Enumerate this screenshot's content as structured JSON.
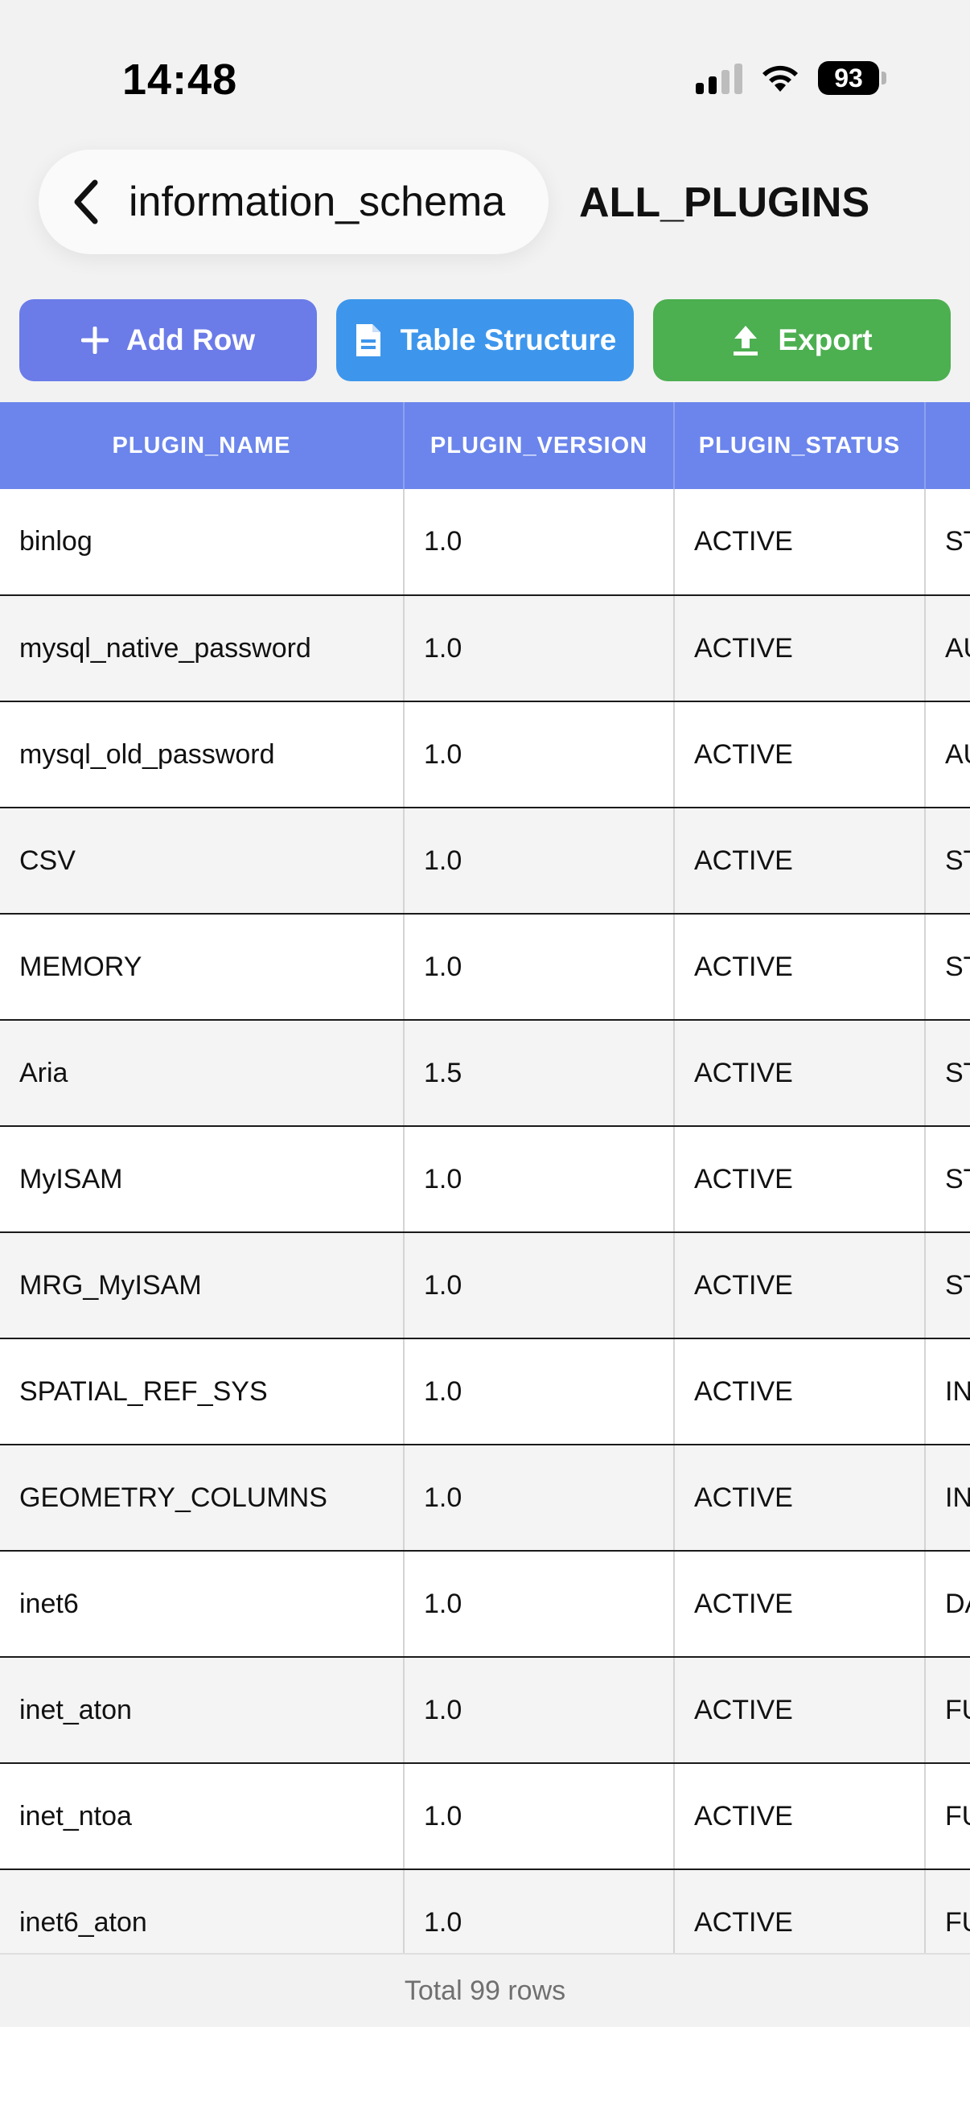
{
  "status_bar": {
    "time": "14:48",
    "battery": "93"
  },
  "nav": {
    "back_label": "information_schema",
    "title": "ALL_PLUGINS"
  },
  "toolbar": {
    "add_row_label": "Add Row",
    "table_structure_label": "Table Structure",
    "export_label": "Export"
  },
  "colors": {
    "header": "#6b85ec",
    "add_row": "#6b7be8",
    "table_structure": "#3d96ec",
    "export": "#4caf50"
  },
  "table": {
    "columns": [
      "PLUGIN_NAME",
      "PLUGIN_VERSION",
      "PLUGIN_STATUS",
      ""
    ],
    "rows": [
      [
        "binlog",
        "1.0",
        "ACTIVE",
        "ST"
      ],
      [
        "mysql_native_password",
        "1.0",
        "ACTIVE",
        "AU"
      ],
      [
        "mysql_old_password",
        "1.0",
        "ACTIVE",
        "AU"
      ],
      [
        "CSV",
        "1.0",
        "ACTIVE",
        "ST"
      ],
      [
        "MEMORY",
        "1.0",
        "ACTIVE",
        "ST"
      ],
      [
        "Aria",
        "1.5",
        "ACTIVE",
        "ST"
      ],
      [
        "MyISAM",
        "1.0",
        "ACTIVE",
        "ST"
      ],
      [
        "MRG_MyISAM",
        "1.0",
        "ACTIVE",
        "ST"
      ],
      [
        "SPATIAL_REF_SYS",
        "1.0",
        "ACTIVE",
        "IN"
      ],
      [
        "GEOMETRY_COLUMNS",
        "1.0",
        "ACTIVE",
        "IN"
      ],
      [
        "inet6",
        "1.0",
        "ACTIVE",
        "DA"
      ],
      [
        "inet_aton",
        "1.0",
        "ACTIVE",
        "FU"
      ],
      [
        "inet_ntoa",
        "1.0",
        "ACTIVE",
        "FU"
      ],
      [
        "inet6_aton",
        "1.0",
        "ACTIVE",
        "FU"
      ]
    ]
  },
  "footer": {
    "total_label": "Total 99 rows"
  }
}
